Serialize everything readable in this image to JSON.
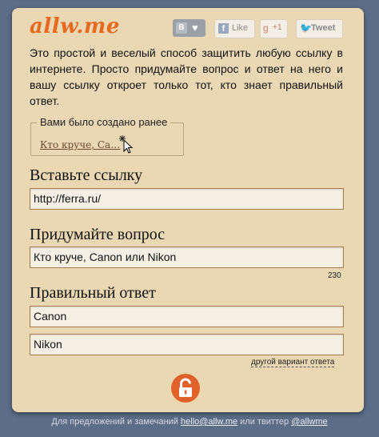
{
  "logo": "allw.me",
  "social": {
    "vk_letter": "В",
    "vk_heart": "♥",
    "fb_label": "Like",
    "gplus_label": "+1",
    "twitter_label": "Tweet"
  },
  "intro": "Это простой и веселый способ защитить любую ссылку в интернете. Просто придумайте вопрос и ответ на него и вашу ссылку откроет только тот, кто знает правильный ответ.",
  "previous": {
    "legend": "Вами было создано ранее",
    "link": "Кто круче, Ca…"
  },
  "form": {
    "link_label": "Вставьте ссылку",
    "link_value": "http://ferra.ru/",
    "question_label": "Придумайте вопрос",
    "question_value": "Кто круче, Canon или Nikon",
    "question_counter": "230",
    "answer_label": "Правильный ответ",
    "answer_value": "Canon",
    "alt_answer_value": "Nikon",
    "alt_answer_link": "другой вариант ответа"
  },
  "footer": {
    "text_before": "Для предложений и замечаний",
    "email": "hello@allw.me",
    "text_middle": "или твиттер",
    "twitter": "@allwme"
  },
  "colors": {
    "background": "#5c6d87",
    "card": "#ead7b3",
    "accent": "#e86a21"
  },
  "icons": [
    "vk-icon",
    "heart-icon",
    "facebook-icon",
    "google-plus-icon",
    "twitter-icon",
    "cursor-icon",
    "unlock-icon"
  ]
}
